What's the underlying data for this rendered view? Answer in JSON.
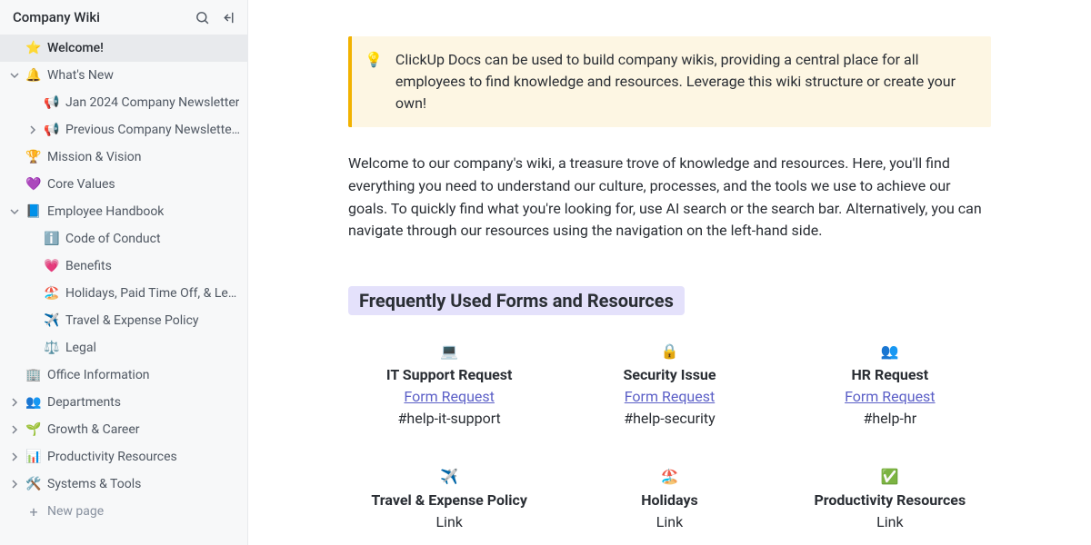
{
  "sidebar": {
    "title": "Company Wiki",
    "new_page": "New page",
    "items": [
      {
        "icon": "⭐",
        "label": "Welcome!",
        "active": true,
        "depth": 0
      },
      {
        "icon": "🔔",
        "label": "What's New",
        "depth": 0,
        "chev": "down",
        "icon_color": "#f2b200"
      },
      {
        "icon": "📢",
        "label": "Jan 2024 Company Newsletter",
        "depth": 1,
        "icon_color": "#f2b200"
      },
      {
        "icon": "📢",
        "label": "Previous Company Newsletters",
        "depth": 1,
        "chev": "right",
        "icon_color": "#f2b200"
      },
      {
        "icon": "🏆",
        "label": "Mission & Vision",
        "depth": 0,
        "icon_color": "#8c9bab"
      },
      {
        "icon": "💜",
        "label": "Core Values",
        "depth": 0
      },
      {
        "icon": "📘",
        "label": "Employee Handbook",
        "depth": 0,
        "chev": "down"
      },
      {
        "icon": "ℹ️",
        "label": "Code of Conduct",
        "depth": 2
      },
      {
        "icon": "💗",
        "label": "Benefits",
        "depth": 2
      },
      {
        "icon": "🏖️",
        "label": "Holidays, Paid Time Off, & Leave...",
        "depth": 2
      },
      {
        "icon": "✈️",
        "label": "Travel & Expense Policy",
        "depth": 2
      },
      {
        "icon": "⚖️",
        "label": "Legal",
        "depth": 2
      },
      {
        "icon": "🏢",
        "label": "Office Information",
        "depth": 0,
        "icon_color": "#14a862"
      },
      {
        "icon": "👥",
        "label": "Departments",
        "depth": 0,
        "chev": "right",
        "icon_color": "#8c9bab"
      },
      {
        "icon": "🌱",
        "label": "Growth & Career",
        "depth": 0,
        "chev": "right"
      },
      {
        "icon": "📊",
        "label": "Productivity Resources",
        "depth": 0,
        "chev": "right",
        "icon_color": "#8c9bab"
      },
      {
        "icon": "🛠️",
        "label": "Systems & Tools",
        "depth": 0,
        "chev": "right",
        "icon_color": "#8c9bab"
      }
    ]
  },
  "main": {
    "callout": "ClickUp Docs can be used to build company wikis, providing a central place for all employees to find knowledge and resources. Leverage this wiki structure or create your own!",
    "intro": "Welcome to our company's wiki, a treasure trove of knowledge and resources. Here, you'll find everything you need to understand our culture, processes, and the tools we use to achieve our goals. To quickly find what you're looking for, use AI search or the search bar. Alternatively, you can navigate through our resources using the navigation on the left-hand side.",
    "section_title": "Frequently Used Forms and Resources",
    "cards": [
      {
        "emoji": "💻",
        "title": "IT Support Request",
        "link": "Form Request",
        "sub": "#help-it-support"
      },
      {
        "emoji": "🔒",
        "title": "Security Issue",
        "link": "Form Request",
        "sub": "#help-security"
      },
      {
        "emoji": "👥",
        "title": "HR Request",
        "link": "Form Request",
        "sub": "#help-hr"
      },
      {
        "emoji": "✈️",
        "title": "Travel & Expense Policy",
        "link": "Link",
        "sub": ""
      },
      {
        "emoji": "🏖️",
        "title": "Holidays",
        "link": "Link",
        "sub": ""
      },
      {
        "emoji": "✅",
        "title": "Productivity Resources",
        "link": "Link",
        "sub": ""
      }
    ]
  }
}
